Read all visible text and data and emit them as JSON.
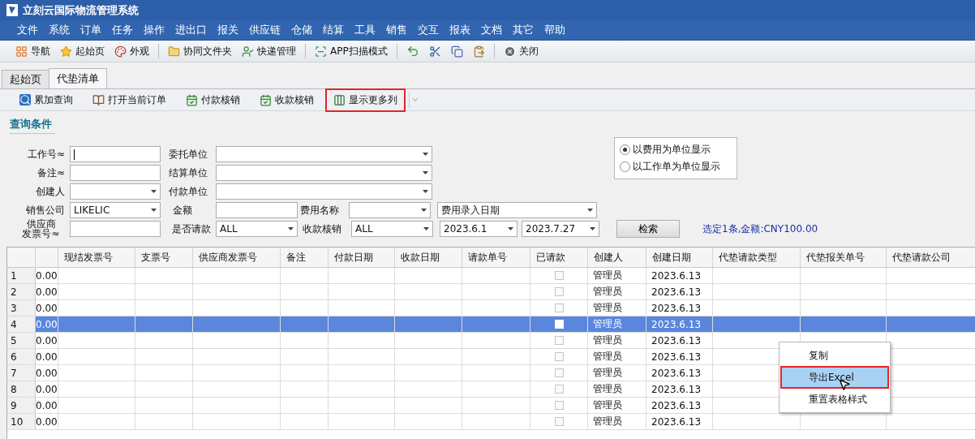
{
  "window": {
    "title": "立刻云国际物流管理系统"
  },
  "menu": [
    "文件",
    "系统",
    "订单",
    "任务",
    "操作",
    "进出口",
    "报关",
    "供应链",
    "仓储",
    "结算",
    "工具",
    "销售",
    "交互",
    "报表",
    "文档",
    "其它",
    "帮助"
  ],
  "toolbar": [
    {
      "kind": "nav",
      "label": "导航"
    },
    {
      "kind": "star",
      "label": "起始页"
    },
    {
      "kind": "palette",
      "label": "外观"
    },
    {
      "kind": "separator"
    },
    {
      "kind": "folder",
      "label": "协同文件夹"
    },
    {
      "kind": "courier",
      "label": "快递管理"
    },
    {
      "kind": "separator"
    },
    {
      "kind": "scan",
      "label": "APP扫描模式"
    },
    {
      "kind": "separator"
    },
    {
      "kind": "undo"
    },
    {
      "kind": "cut"
    },
    {
      "kind": "copy"
    },
    {
      "kind": "paste"
    },
    {
      "kind": "separator"
    },
    {
      "kind": "close",
      "label": "关闭"
    }
  ],
  "tabs": [
    {
      "label": "起始页",
      "selected": false
    },
    {
      "label": "代垫清单",
      "selected": true
    }
  ],
  "actions": [
    {
      "kind": "query",
      "label": "累加查询",
      "highlighted": false
    },
    {
      "kind": "open",
      "label": "打开当前订单",
      "highlighted": false
    },
    {
      "kind": "pay",
      "label": "付款核销",
      "highlighted": false
    },
    {
      "kind": "receive",
      "label": "收款核销",
      "highlighted": false
    },
    {
      "kind": "columns",
      "label": "显示更多列",
      "highlighted": true
    },
    {
      "kind": "dropdown"
    }
  ],
  "query": {
    "title": "查询条件",
    "rows": [
      [
        {
          "kind": "label",
          "text": "工作号≈"
        },
        {
          "kind": "input",
          "focused": true
        },
        {
          "kind": "label",
          "text": "委托单位"
        },
        {
          "kind": "combo"
        }
      ],
      [
        {
          "kind": "label",
          "text": "备注≈"
        },
        {
          "kind": "input",
          "focused": false
        },
        {
          "kind": "label",
          "text": "结算单位"
        },
        {
          "kind": "combo"
        }
      ],
      [
        {
          "kind": "label",
          "text": "创建人"
        },
        {
          "kind": "combo"
        },
        {
          "kind": "label",
          "text": "付款单位"
        },
        {
          "kind": "combo"
        }
      ],
      [
        {
          "kind": "label",
          "text": "销售公司"
        },
        {
          "kind": "combo",
          "value": "LIKELIC"
        },
        {
          "kind": "label",
          "text": "金额"
        },
        {
          "kind": "input",
          "focused": false
        },
        {
          "kind": "label",
          "text": "费用名称"
        },
        {
          "kind": "combo"
        },
        {
          "kind": "combo",
          "value": "费用录入日期"
        }
      ],
      [
        {
          "kind": "label",
          "text": "供应商发票号≈"
        },
        {
          "kind": "input",
          "focused": false
        },
        {
          "kind": "label",
          "text": "是否请款"
        },
        {
          "kind": "combo",
          "value": "ALL"
        },
        {
          "kind": "label",
          "text": "收款核销"
        },
        {
          "kind": "combo",
          "value": "ALL"
        },
        {
          "kind": "combo",
          "value": "2023.6.1"
        },
        {
          "kind": "combo",
          "value": "2023.7.27"
        }
      ]
    ],
    "display_mode": [
      {
        "label": "以费用为单位显示",
        "selected": true
      },
      {
        "label": "以工作单为单位显示",
        "selected": false
      }
    ],
    "search_button": "检索",
    "summary": "选定1条,金额:CNY100.00"
  },
  "table": {
    "columns": [
      "现结发票号",
      "支票号",
      "供应商发票号",
      "备注",
      "付款日期",
      "收款日期",
      "请款单号",
      "已请款",
      "创建人",
      "创建日期",
      "代垫请款类型",
      "代垫报关单号",
      "代垫请款公司"
    ],
    "rows": [
      {
        "row": "1",
        "amount": "0.00",
        "checked": false,
        "creator": "管理员",
        "date": "2023.6.13",
        "selected": false
      },
      {
        "row": "2",
        "amount": "0.00",
        "checked": false,
        "creator": "管理员",
        "date": "2023.6.13",
        "selected": false
      },
      {
        "row": "3",
        "amount": "0.00",
        "checked": false,
        "creator": "管理员",
        "date": "2023.6.13",
        "selected": false
      },
      {
        "row": "4",
        "amount": "0.00",
        "checked": false,
        "creator": "管理员",
        "date": "2023.6.13",
        "selected": true
      },
      {
        "row": "5",
        "amount": "0.00",
        "checked": false,
        "creator": "管理员",
        "date": "2023.6.13",
        "selected": false
      },
      {
        "row": "6",
        "amount": "0.00",
        "checked": false,
        "creator": "管理员",
        "date": "2023.6.13",
        "selected": false
      },
      {
        "row": "7",
        "amount": "0.00",
        "checked": false,
        "creator": "管理员",
        "date": "2023.6.13",
        "selected": false
      },
      {
        "row": "8",
        "amount": "0.00",
        "checked": false,
        "creator": "管理员",
        "date": "2023.6.13",
        "selected": false
      },
      {
        "row": "9",
        "amount": "0.00",
        "checked": false,
        "creator": "管理员",
        "date": "2023.6.13",
        "selected": false
      },
      {
        "row": "10",
        "amount": "0.00",
        "checked": false,
        "creator": "管理员",
        "date": "2023.6.13",
        "selected": false
      }
    ]
  },
  "context_menu": [
    {
      "label": "复制",
      "selected": false,
      "highlighted": false
    },
    {
      "label": "导出Excel",
      "selected": true,
      "highlighted": true
    },
    {
      "label": "重置表格样式",
      "selected": false,
      "highlighted": false
    }
  ]
}
